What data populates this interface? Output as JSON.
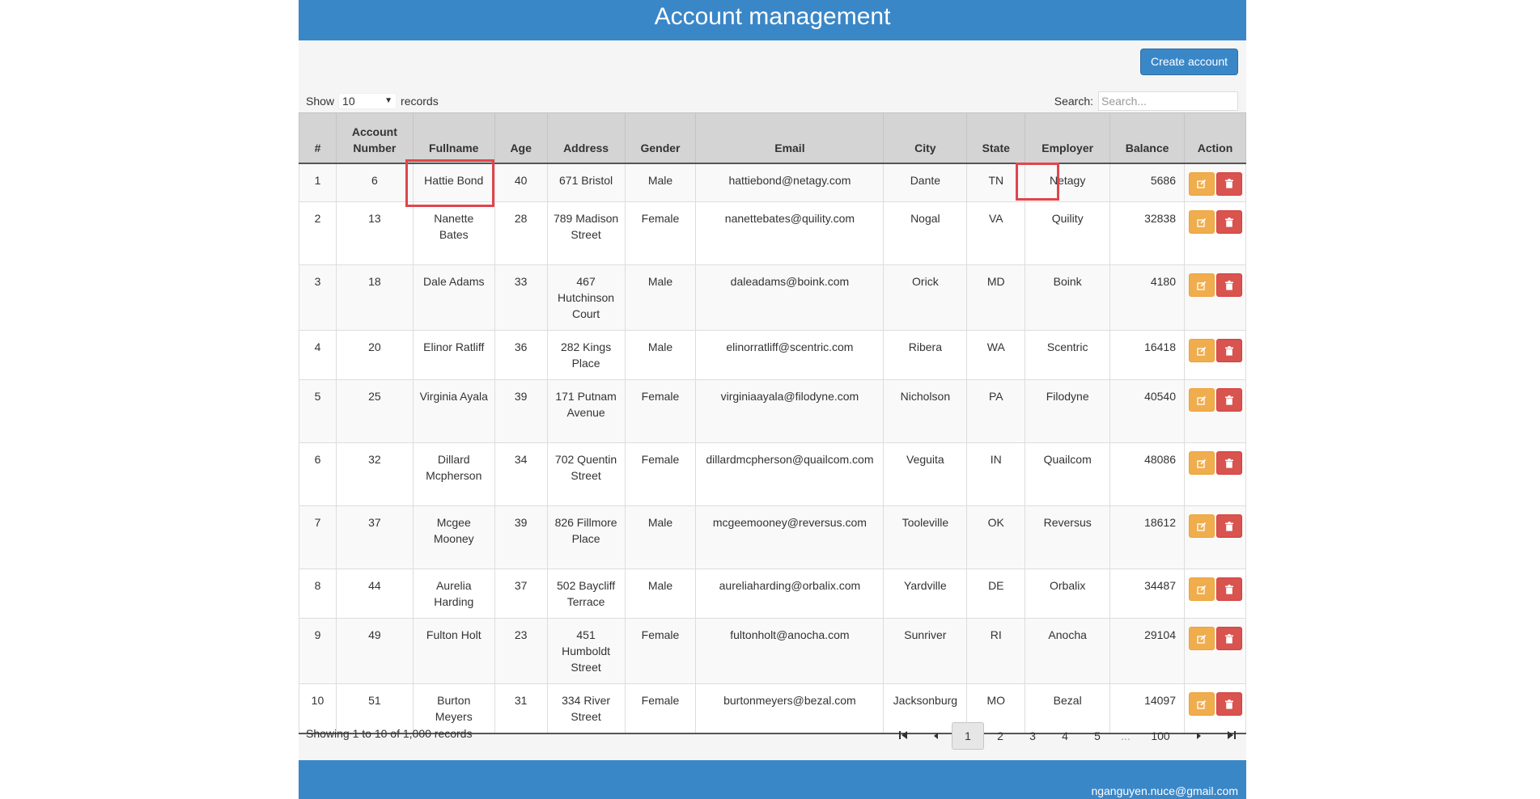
{
  "header": {
    "title": "Account management"
  },
  "toolbar": {
    "create_label": "Create account"
  },
  "controls": {
    "show_label": "Show",
    "page_size": "10",
    "records_label": "records",
    "search_label": "Search:",
    "search_placeholder": "Search..."
  },
  "table": {
    "columns": [
      "#",
      "Account Number",
      "Fullname",
      "Age",
      "Address",
      "Gender",
      "Email",
      "City",
      "State",
      "Employer",
      "Balance",
      "Action"
    ],
    "rows": [
      {
        "idx": "1",
        "account": "6",
        "fullname": "Hattie Bond",
        "age": "40",
        "address": "671 Bristol",
        "gender": "Male",
        "email": "hattiebond@netagy.com",
        "city": "Dante",
        "state": "TN",
        "employer": "Netagy",
        "balance": "5686"
      },
      {
        "idx": "2",
        "account": "13",
        "fullname": "Nanette Bates",
        "age": "28",
        "address": "789 Madison Street",
        "gender": "Female",
        "email": "nanettebates@quility.com",
        "city": "Nogal",
        "state": "VA",
        "employer": "Quility",
        "balance": "32838"
      },
      {
        "idx": "3",
        "account": "18",
        "fullname": "Dale Adams",
        "age": "33",
        "address": "467 Hutchinson Court",
        "gender": "Male",
        "email": "daleadams@boink.com",
        "city": "Orick",
        "state": "MD",
        "employer": "Boink",
        "balance": "4180"
      },
      {
        "idx": "4",
        "account": "20",
        "fullname": "Elinor Ratliff",
        "age": "36",
        "address": "282 Kings Place",
        "gender": "Male",
        "email": "elinorratliff@scentric.com",
        "city": "Ribera",
        "state": "WA",
        "employer": "Scentric",
        "balance": "16418"
      },
      {
        "idx": "5",
        "account": "25",
        "fullname": "Virginia Ayala",
        "age": "39",
        "address": "171 Putnam Avenue",
        "gender": "Female",
        "email": "virginiaayala@filodyne.com",
        "city": "Nicholson",
        "state": "PA",
        "employer": "Filodyne",
        "balance": "40540"
      },
      {
        "idx": "6",
        "account": "32",
        "fullname": "Dillard Mcpherson",
        "age": "34",
        "address": "702 Quentin Street",
        "gender": "Female",
        "email": "dillardmcpherson@quailcom.com",
        "city": "Veguita",
        "state": "IN",
        "employer": "Quailcom",
        "balance": "48086"
      },
      {
        "idx": "7",
        "account": "37",
        "fullname": "Mcgee Mooney",
        "age": "39",
        "address": "826 Fillmore Place",
        "gender": "Male",
        "email": "mcgeemooney@reversus.com",
        "city": "Tooleville",
        "state": "OK",
        "employer": "Reversus",
        "balance": "18612"
      },
      {
        "idx": "8",
        "account": "44",
        "fullname": "Aurelia Harding",
        "age": "37",
        "address": "502 Baycliff Terrace",
        "gender": "Male",
        "email": "aureliaharding@orbalix.com",
        "city": "Yardville",
        "state": "DE",
        "employer": "Orbalix",
        "balance": "34487"
      },
      {
        "idx": "9",
        "account": "49",
        "fullname": "Fulton Holt",
        "age": "23",
        "address": "451 Humboldt Street",
        "gender": "Female",
        "email": "fultonholt@anocha.com",
        "city": "Sunriver",
        "state": "RI",
        "employer": "Anocha",
        "balance": "29104"
      },
      {
        "idx": "10",
        "account": "51",
        "fullname": "Burton Meyers",
        "age": "31",
        "address": "334 River Street",
        "gender": "Female",
        "email": "burtonmeyers@bezal.com",
        "city": "Jacksonburg",
        "state": "MO",
        "employer": "Bezal",
        "balance": "14097"
      }
    ]
  },
  "footer": {
    "info": "Showing 1 to 10 of 1,000 records",
    "pages": [
      "1",
      "2",
      "3",
      "4",
      "5"
    ],
    "ellipsis": "...",
    "last_page": "100",
    "current_page": "1"
  },
  "bottom": {
    "email": "nganguyen.nuce@gmail.com"
  },
  "colors": {
    "primary": "#3a87c8",
    "edit": "#f0ad4e",
    "delete": "#d9534f",
    "highlight": "#e0454b"
  },
  "icons": {
    "edit": "edit-icon",
    "delete": "trash-icon",
    "first": "first-page-icon",
    "prev": "prev-page-icon",
    "next": "next-page-icon",
    "last": "last-page-icon"
  }
}
